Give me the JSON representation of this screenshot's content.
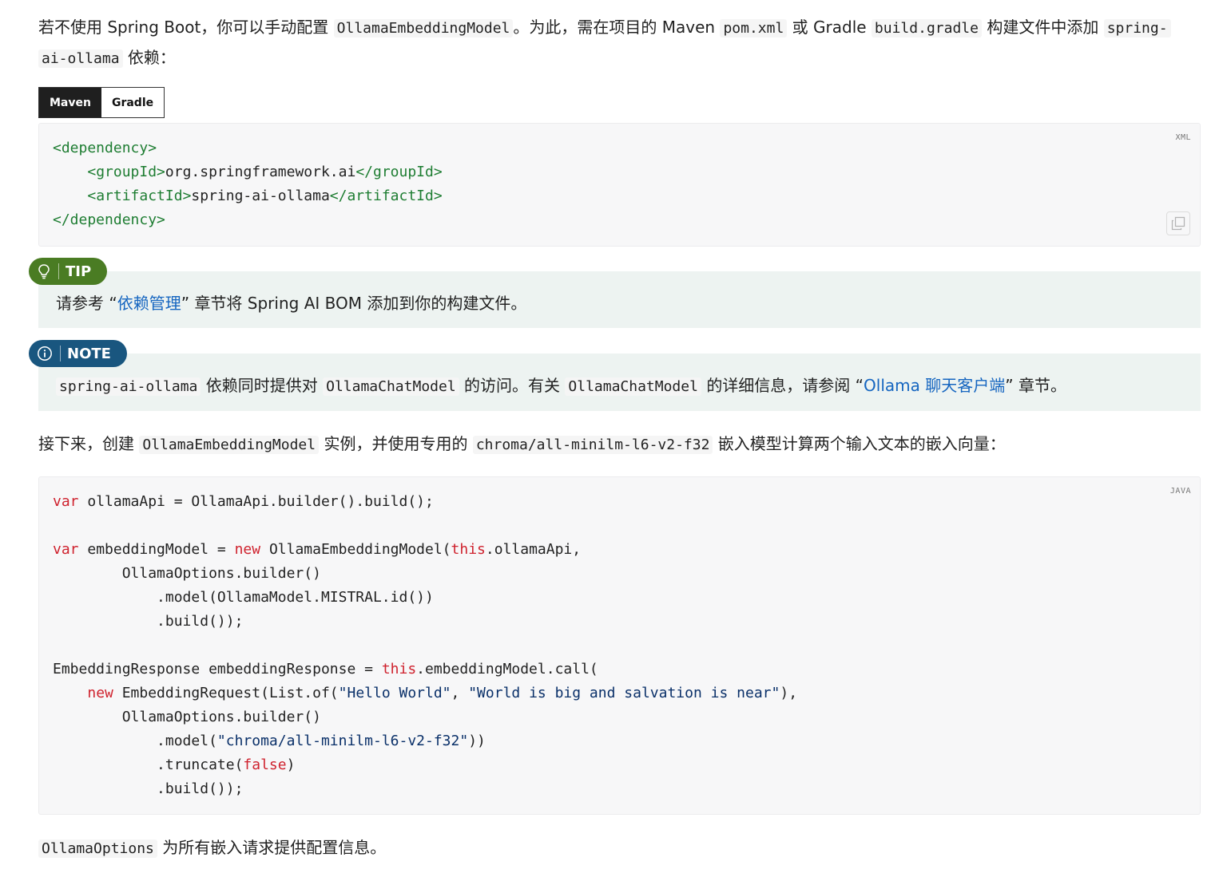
{
  "colors": {
    "tip_badge": "#4a7c23",
    "tip_bg": "#edf3f1",
    "note_badge": "#19567f",
    "note_bg": "#edf3f1",
    "link": "#1565c0"
  },
  "intro": {
    "t1": "若不使用 Spring Boot，你可以手动配置",
    "c1": "OllamaEmbeddingModel",
    "t2": "。为此，需在项目的 Maven",
    "c2": "pom.xml",
    "t3": "或 Gradle",
    "c3": "build.gradle",
    "t4": "构建文件中添加",
    "c4a": "spring-",
    "c4b": "ai-ollama",
    "t5": "依赖："
  },
  "tabs": {
    "maven": "Maven",
    "gradle": "Gradle"
  },
  "xml_block": {
    "lang": "XML",
    "lines": [
      [
        "<dependency>",
        "",
        ""
      ],
      [
        "<groupId>",
        "org.springframework.ai",
        "</groupId>"
      ],
      [
        "<artifactId>",
        "spring-ai-ollama",
        "</artifactId>"
      ],
      [
        "</dependency>",
        "",
        ""
      ]
    ]
  },
  "tip": {
    "label": "TIP",
    "icon": "lightbulb-icon",
    "t1": "请参考 “",
    "link": "依赖管理",
    "t2": "” 章节将 Spring AI BOM 添加到你的构建文件。"
  },
  "note": {
    "label": "NOTE",
    "icon": "info-circle-icon",
    "c1": "spring-ai-ollama",
    "t1": "依赖同时提供对",
    "c2": "OllamaChatModel",
    "t2": "的访问。有关",
    "c3": "OllamaChatModel",
    "t3": "的详细信息，请参阅 “",
    "link": "Ollama 聊天客户端",
    "t4": "” 章节。"
  },
  "next": {
    "t1": "接下来，创建",
    "c1": "OllamaEmbeddingModel",
    "t2": "实例，并使用专用的",
    "c2": "chroma/all-minilm-l6-v2-f32",
    "t3": "嵌入模型计算两个输入文本的嵌入向量："
  },
  "java_block": {
    "lang": "JAVA",
    "kw_var": "var",
    "kw_new": "new",
    "kw_this": "this",
    "lit_false": "false",
    "s_hello": "\"Hello World\"",
    "s_world": "\"World is big and salvation is near\"",
    "s_model": "\"chroma/all-minilm-l6-v2-f32\"",
    "l1": " ollamaApi = OllamaApi.builder().build();",
    "l3": " embeddingModel = ",
    "l3b": " OllamaEmbeddingModel(",
    "l3c": ".ollamaApi,",
    "l4": "        OllamaOptions.builder()",
    "l5": "            .model(OllamaModel.MISTRAL.id())",
    "l6": "            .build());",
    "l8": "EmbeddingResponse embeddingResponse = ",
    "l8b": ".embeddingModel.call(",
    "l9a": "    ",
    "l9b": " EmbeddingRequest(List.of(",
    "l9c": ", ",
    "l9d": "),",
    "l10": "        OllamaOptions.builder()",
    "l11a": "            .model(",
    "l11b": "))",
    "l12a": "            .truncate(",
    "l12b": ")",
    "l13": "            .build());"
  },
  "footer": {
    "c1": "OllamaOptions",
    "t1": "为所有嵌入请求提供配置信息。"
  }
}
